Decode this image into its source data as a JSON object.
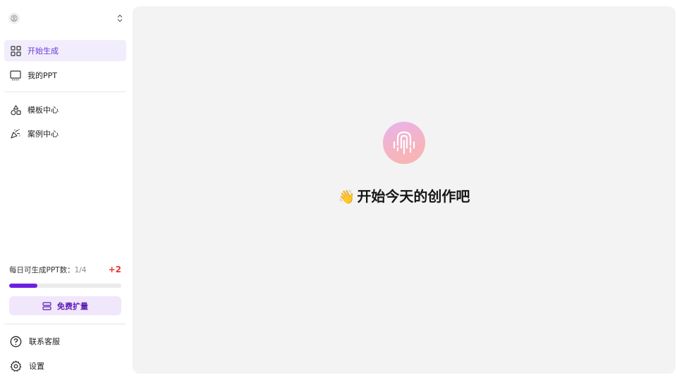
{
  "sidebar": {
    "nav": [
      {
        "label": "开始生成",
        "icon": "grid-icon",
        "active": true
      },
      {
        "label": "我的PPT",
        "icon": "monitor-icon",
        "active": false
      },
      {
        "label": "模板中心",
        "icon": "shapes-icon",
        "active": false
      },
      {
        "label": "案例中心",
        "icon": "party-popper-icon",
        "active": false
      }
    ],
    "quota": {
      "label": "每日可生成PPT数：",
      "count": "1/4",
      "bonus": "+2",
      "progress_fraction": 0.25
    },
    "expand_button": "免费扩量",
    "bottom": [
      {
        "label": "联系客服",
        "icon": "help-circle-icon"
      },
      {
        "label": "设置",
        "icon": "gear-icon"
      }
    ]
  },
  "main": {
    "wave": "👋",
    "welcome": "开始今天的创作吧"
  },
  "colors": {
    "accent": "#6d1fe0",
    "active_bg": "#f1edfd",
    "expand_bg": "#f1e7fb",
    "bonus": "#e53935",
    "main_bg": "#f3f3f3"
  }
}
